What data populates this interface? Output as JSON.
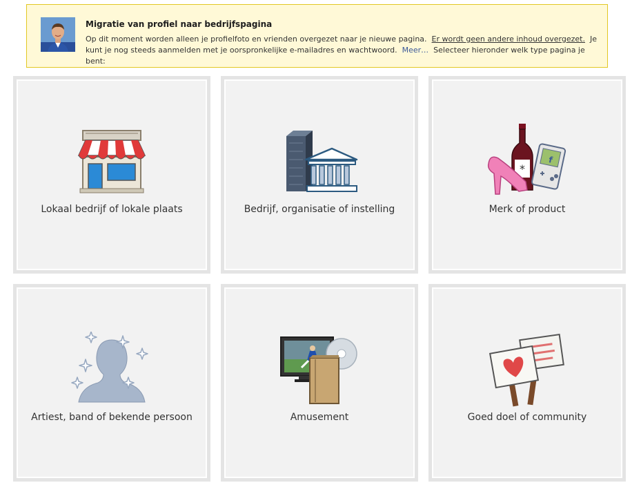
{
  "notice": {
    "title": "Migratie van profiel naar bedrijfspagina",
    "text_1": "Op dit moment worden alleen je profielfoto en vrienden overgezet naar je nieuwe pagina.",
    "link_no_other": "Er wordt geen andere inhoud overgezet.",
    "text_2": "Je kunt je nog steeds aanmelden met je oorspronkelijke e-mailadres en wachtwoord.",
    "link_more": "Meer…",
    "text_3": "Selecteer hieronder welk type pagina je bent:"
  },
  "categories": [
    {
      "label": "Lokaal bedrijf of lokale plaats",
      "icon": "storefront-icon"
    },
    {
      "label": "Bedrijf, organisatie of instelling",
      "icon": "buildings-icon"
    },
    {
      "label": "Merk of product",
      "icon": "products-icon"
    },
    {
      "label": "Artiest, band of bekende persoon",
      "icon": "celebrity-icon"
    },
    {
      "label": "Amusement",
      "icon": "entertainment-icon"
    },
    {
      "label": "Goed doel of community",
      "icon": "cause-signs-icon"
    }
  ],
  "colors": {
    "notice_bg": "#fff9d7",
    "notice_border": "#e2c822",
    "tile_bg": "#f2f2f2",
    "link": "#3b5998"
  }
}
